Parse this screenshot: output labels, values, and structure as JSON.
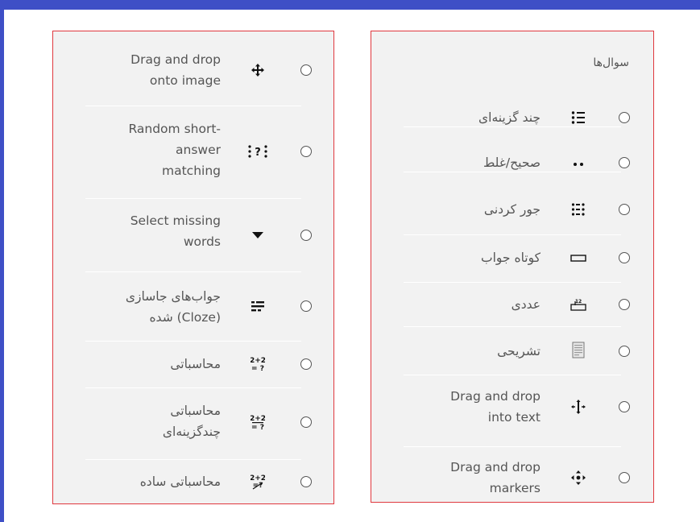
{
  "left_panel": {
    "items": [
      {
        "label": "Drag and drop onto image",
        "lines": [
          "Drag and drop",
          "onto image"
        ],
        "icon": "move-icon"
      },
      {
        "label": "Random short-answer matching",
        "lines": [
          "Random short-",
          "answer",
          "matching"
        ],
        "icon": "random-match-icon"
      },
      {
        "label": "Select missing words",
        "lines": [
          "Select missing",
          "words"
        ],
        "icon": "dropdown-triangle-icon"
      },
      {
        "label": "جواب‌های جاسازی شده (Cloze)",
        "lines": [
          "جواب‌های جاسازی",
          "شده (Cloze)"
        ],
        "icon": "cloze-icon"
      },
      {
        "label": "محاسباتی",
        "lines": [
          "محاسباتی"
        ],
        "icon": "calculated-icon"
      },
      {
        "label": "محاسباتی چندگزینه‌ای",
        "lines": [
          "محاسباتی",
          "چندگزینه‌ای"
        ],
        "icon": "calculated-multi-icon"
      },
      {
        "label": "محاسباتی ساده",
        "lines": [
          "محاسباتی ساده"
        ],
        "icon": "calculated-simple-icon"
      }
    ]
  },
  "right_panel": {
    "heading": "سوال‌ها",
    "items": [
      {
        "label": "چند گزینه‌ای",
        "lines": [
          "چند گزینه‌ای"
        ],
        "icon": "multichoice-list-icon"
      },
      {
        "label": "صحیح/غلط",
        "lines": [
          "صحیح/غلط"
        ],
        "icon": "true-false-dots-icon"
      },
      {
        "label": "جور کردنی",
        "lines": [
          "جور کردنی"
        ],
        "icon": "matching-grid-icon"
      },
      {
        "label": "کوتاه جواب",
        "lines": [
          "کوتاه جواب"
        ],
        "icon": "short-answer-box-icon"
      },
      {
        "label": "عددی",
        "lines": [
          "عددی"
        ],
        "icon": "numerical-icon"
      },
      {
        "label": "تشریحی",
        "lines": [
          "تشریحی"
        ],
        "icon": "essay-icon"
      },
      {
        "label": "Drag and drop into text",
        "lines": [
          "Drag and drop",
          "into text"
        ],
        "icon": "drag-into-text-icon"
      },
      {
        "label": "Drag and drop markers",
        "lines": [
          "Drag and drop",
          "markers"
        ],
        "icon": "drag-markers-icon"
      }
    ]
  }
}
